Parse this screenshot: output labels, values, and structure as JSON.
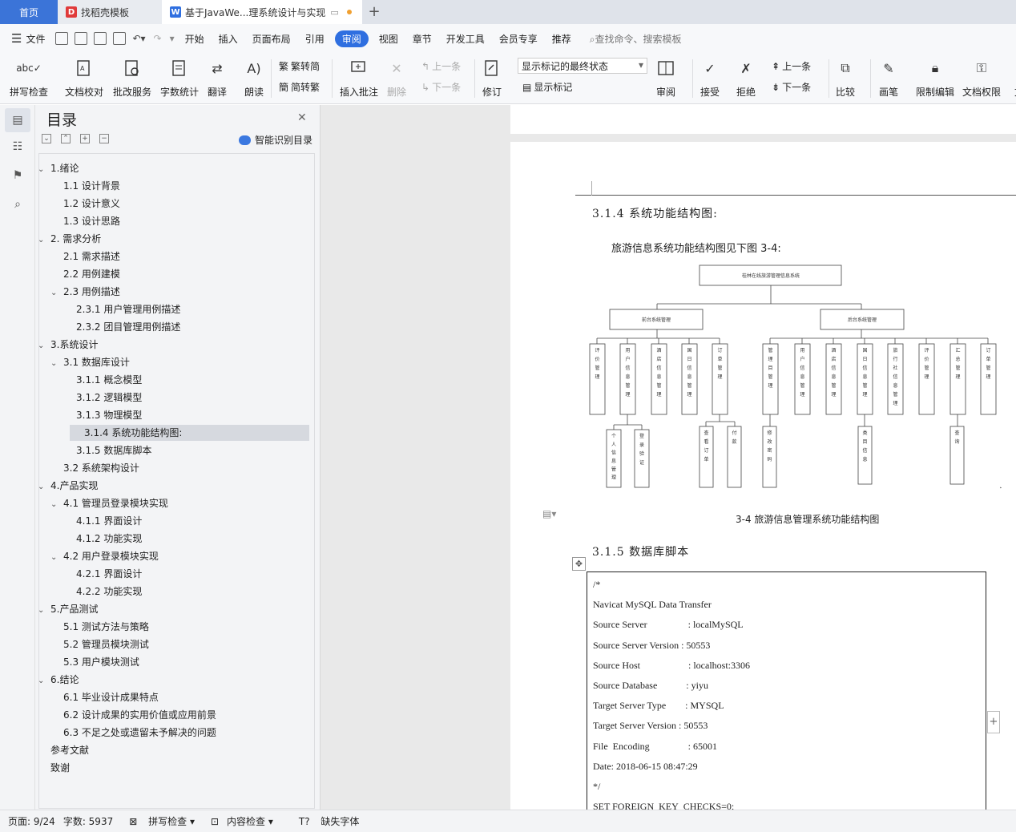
{
  "tabs": {
    "home": "首页",
    "template": "找稻壳模板",
    "doc": "基于JavaWe...理系统设计与实现"
  },
  "menu": {
    "file": "文件",
    "items": [
      "开始",
      "插入",
      "页面布局",
      "引用",
      "审阅",
      "视图",
      "章节",
      "开发工具",
      "会员专享",
      "推荐"
    ],
    "active": "审阅",
    "search": "查找命令、搜索模板"
  },
  "ribbon": {
    "spell": "拼写检查",
    "proof": "文档校对",
    "review_service": "批改服务",
    "word_count": "字数统计",
    "translate": "翻译",
    "read": "朗读",
    "trad": "繁转简",
    "simp": "简转繁",
    "insert_comment": "插入批注",
    "delete": "删除",
    "prev": "上一条",
    "next": "下一条",
    "revise": "修订",
    "markup_select": "显示标记的最终状态",
    "show_markup": "显示标记",
    "review": "审阅",
    "accept": "接受",
    "reject": "拒绝",
    "prev2": "上一条",
    "next2": "下一条",
    "compare": "比较",
    "pen": "画笔",
    "restrict": "限制编辑",
    "doc_perm": "文档权限",
    "more": "文"
  },
  "toc": {
    "title": "目录",
    "smart": "智能识别目录",
    "items": [
      {
        "text": "1.绪论",
        "level": 0,
        "exp": true
      },
      {
        "text": "1.1 设计背景",
        "level": 1
      },
      {
        "text": "1.2 设计意义",
        "level": 1
      },
      {
        "text": "1.3 设计思路",
        "level": 1
      },
      {
        "text": "2. 需求分析",
        "level": 0,
        "exp": true
      },
      {
        "text": "2.1  需求描述",
        "level": 1
      },
      {
        "text": "2.2  用例建模",
        "level": 1
      },
      {
        "text": "2.3  用例描述",
        "level": 1,
        "exp": true
      },
      {
        "text": "2.3.1  用户管理用例描述",
        "level": 2
      },
      {
        "text": "2.3.2  团目管理用例描述",
        "level": 2
      },
      {
        "text": "3.系统设计",
        "level": 0,
        "exp": true
      },
      {
        "text": "3.1  数据库设计",
        "level": 1,
        "exp": true
      },
      {
        "text": "3.1.1  概念模型",
        "level": 2
      },
      {
        "text": "3.1.2  逻辑模型",
        "level": 2
      },
      {
        "text": "3.1.3  物理模型",
        "level": 2
      },
      {
        "text": "3.1.4  系统功能结构图:",
        "level": 2,
        "hl": true
      },
      {
        "text": "3.1.5  数据库脚本",
        "level": 2
      },
      {
        "text": "3.2  系统架构设计",
        "level": 1
      },
      {
        "text": "4.产品实现",
        "level": 0,
        "exp": true
      },
      {
        "text": "4.1  管理员登录模块实现",
        "level": 1,
        "exp": true
      },
      {
        "text": "4.1.1  界面设计",
        "level": 2
      },
      {
        "text": "4.1.2  功能实现",
        "level": 2
      },
      {
        "text": "4.2  用户登录模块实现",
        "level": 1,
        "exp": true
      },
      {
        "text": "4.2.1  界面设计",
        "level": 2
      },
      {
        "text": "4.2.2  功能实现",
        "level": 2
      },
      {
        "text": "5.产品测试",
        "level": 0,
        "exp": true
      },
      {
        "text": "5.1  测试方法与策略",
        "level": 1
      },
      {
        "text": "5.2 管理员模块测试",
        "level": 1
      },
      {
        "text": "5.3  用户模块测试",
        "level": 1
      },
      {
        "text": "6.结论",
        "level": 0,
        "exp": true
      },
      {
        "text": "6.1 毕业设计成果特点",
        "level": 1
      },
      {
        "text": "6.2 设计成果的实用价值或应用前景",
        "level": 1
      },
      {
        "text": "6.3 不足之处或遗留未予解决的问题",
        "level": 1
      },
      {
        "text": "参考文献",
        "level": 0
      },
      {
        "text": "致谢",
        "level": 0
      }
    ]
  },
  "doc": {
    "h314": "3.1.4  系统功能结构图:",
    "para": "旅游信息系统功能结构图见下图 3-4:",
    "caption": "3-4  旅游信息管理系统功能结构图",
    "h315": "3.1.5  数据库脚本",
    "diagram": {
      "root": "桂林在线旅游管理信息系统",
      "front": "前台系统管理",
      "back": "后台系统管理",
      "front_children": [
        "评价管理",
        "用户信息管理",
        "酒店信息管理",
        "国日信息管理",
        "订单管理"
      ],
      "back_children": [
        "管理目管理",
        "用户信息管理",
        "酒店信息管理",
        "国日信息管理",
        "旅行社信息管理",
        "评价管理",
        "汇总管理",
        "订单管理"
      ],
      "user_sub": [
        "个人信息管理",
        "登录验证"
      ],
      "order_sub": [
        "查看订单",
        "付款"
      ],
      "admin_sub": [
        "修改密码"
      ],
      "route_sub": [
        "类目信息"
      ],
      "summary_sub": [
        "查询"
      ]
    },
    "code": [
      "/*",
      "Navicat MySQL Data Transfer",
      "Source Server                 : localMySQL",
      "Source Server Version : 50553",
      "Source Host                    : localhost:3306",
      "Source Database            : yiyu",
      "Target Server Type        : MYSQL",
      "Target Server Version : 50553",
      "File  Encoding                : 65001",
      "Date: 2018-06-15 08:47:29",
      "*/",
      "SET FOREIGN_KEY_CHECKS=0;"
    ]
  },
  "status": {
    "page": "页面: 9/24",
    "words": "字数: 5937",
    "spell": "拼写检查",
    "content": "内容检查",
    "font": "缺失字体"
  }
}
